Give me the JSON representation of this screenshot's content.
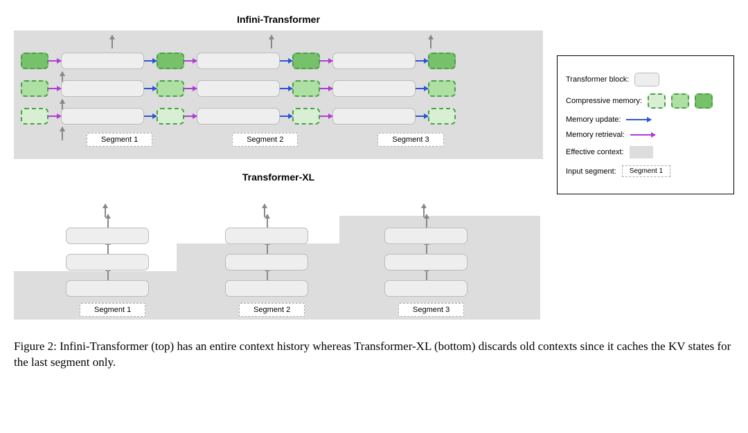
{
  "titles": {
    "infini": "Infini-Transformer",
    "xl": "Transformer-XL"
  },
  "segments": [
    "Segment 1",
    "Segment 2",
    "Segment 3"
  ],
  "legend": {
    "transformer_block": "Transformer block:",
    "compressive_memory": "Compressive memory:",
    "memory_update": "Memory update:",
    "memory_retrieval": "Memory retrieval:",
    "effective_context": "Effective context:",
    "input_segment": "Input segment:",
    "input_segment_example": "Segment 1"
  },
  "caption": "Figure 2: Infini-Transformer (top) has an entire context history whereas Transformer-XL (bottom) discards old contexts since it caches the KV states for the last segment only.",
  "chart_data": {
    "type": "diagram",
    "models": [
      {
        "name": "Infini-Transformer",
        "layers": 3,
        "segments": 3,
        "memory_shades": [
          "light",
          "medium",
          "dark"
        ],
        "memory_before_each_block": true,
        "memory_after_last_block": true,
        "horizontal_arrows": [
          "retrieval (purple)",
          "update (blue)"
        ],
        "vertical_arrows": "gray (between layers and output)",
        "effective_context": "full rectangle (all segments covered)"
      },
      {
        "name": "Transformer-XL",
        "layers": 3,
        "segments": 3,
        "effective_context": "staircase — each new segment adds one layer height of gray; only last segment cached",
        "vertical_arrows": "gray (between layers and output)"
      }
    ],
    "legend_items": [
      "Transformer block",
      "Compressive memory (3 shades, dashed green)",
      "Memory update (blue arrow)",
      "Memory retrieval (purple arrow)",
      "Effective context (gray fill)",
      "Input segment (dashed white box)"
    ]
  }
}
